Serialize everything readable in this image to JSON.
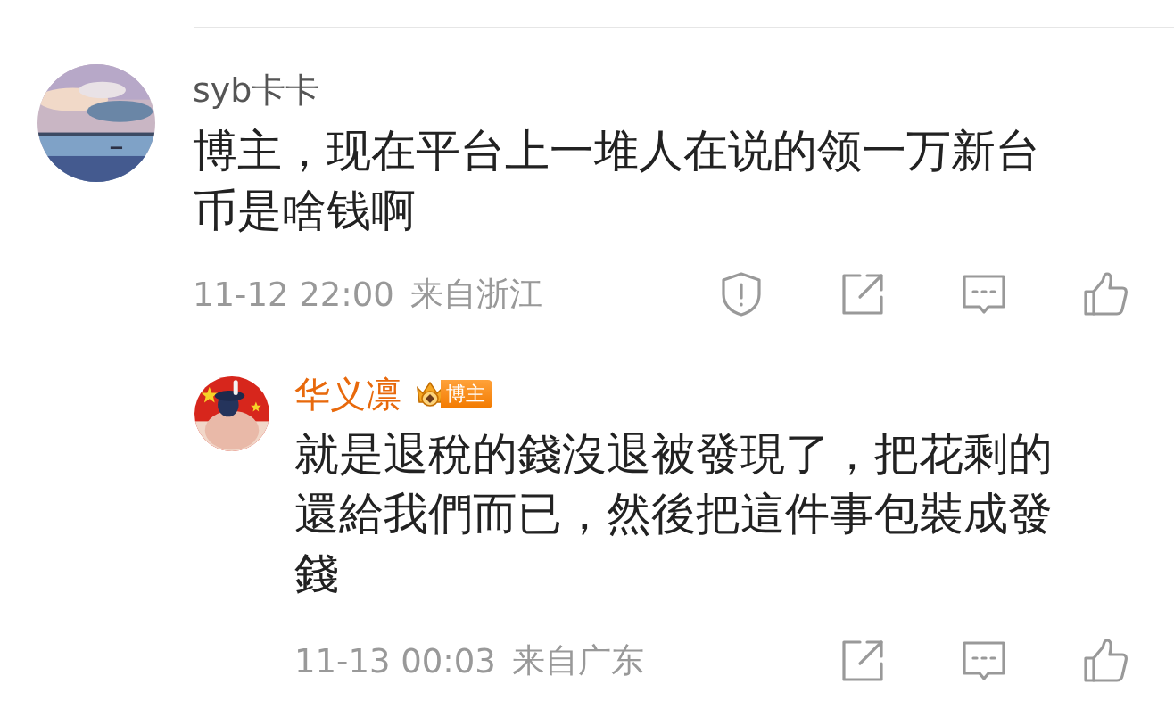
{
  "comments": [
    {
      "author": "syb卡卡",
      "text": "博主，现在平台上一堆人在说的领一万新台币是啥钱啊",
      "time": "11-12 22:00",
      "location": "来自浙江",
      "avatar": {
        "kind": "picture"
      },
      "actions": [
        {
          "kind": "report"
        },
        {
          "kind": "share"
        },
        {
          "kind": "comment"
        },
        {
          "kind": "like"
        }
      ],
      "replies": [
        {
          "author": "华义凛",
          "badge": "博主",
          "text": "就是退稅的錢沒退被發現了，把花剩的還給我們而已，然後把這件事包裝成發錢",
          "time": "11-13 00:03",
          "location": "来自广东",
          "avatar": {
            "kind": "picture"
          },
          "actions": [
            {
              "kind": "share"
            },
            {
              "kind": "comment"
            },
            {
              "kind": "like"
            }
          ]
        }
      ]
    }
  ]
}
